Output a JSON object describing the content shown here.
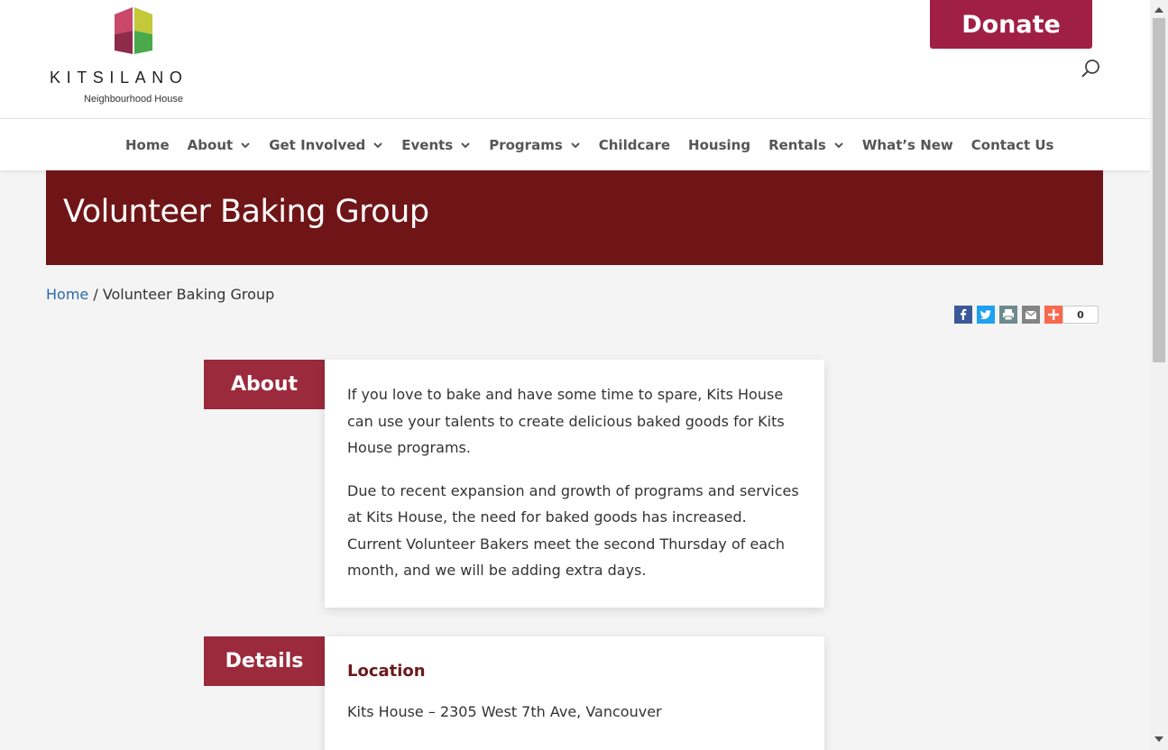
{
  "colors": {
    "brand_red": "#a01f45",
    "banner": "#701517",
    "label_bg": "#9a2a3c",
    "link": "#2a6aa8",
    "heading": "#6b1a1c"
  },
  "logo": {
    "wordmark": "KITSILANO",
    "subtitle": "Neighbourhood House",
    "icon": "kits-house-logo-icon"
  },
  "header": {
    "donate_label": "Donate",
    "search_icon": "search-icon"
  },
  "nav": {
    "items": [
      {
        "label": "Home",
        "has_dropdown": false
      },
      {
        "label": "About",
        "has_dropdown": true
      },
      {
        "label": "Get Involved",
        "has_dropdown": true
      },
      {
        "label": "Events",
        "has_dropdown": true
      },
      {
        "label": "Programs",
        "has_dropdown": true
      },
      {
        "label": "Childcare",
        "has_dropdown": false
      },
      {
        "label": "Housing",
        "has_dropdown": false
      },
      {
        "label": "Rentals",
        "has_dropdown": true
      },
      {
        "label": "What’s New",
        "has_dropdown": false
      },
      {
        "label": "Contact Us",
        "has_dropdown": false
      }
    ]
  },
  "page": {
    "title": "Volunteer Baking Group"
  },
  "breadcrumb": {
    "home": "Home",
    "separator": " / ",
    "current": "Volunteer Baking Group"
  },
  "share": {
    "buttons": [
      "facebook-icon",
      "twitter-icon",
      "print-icon",
      "email-icon",
      "plus-icon"
    ],
    "count": "0"
  },
  "sections": {
    "about": {
      "label": "About",
      "paragraphs": [
        "If you love to bake and have some time to spare, Kits House can use your talents to create delicious baked goods for Kits House programs.",
        "Due to recent expansion and growth of programs and services at Kits House, the need for baked goods has increased. Current Volunteer Bakers meet the second Thursday of each month, and we will be adding extra days."
      ]
    },
    "details": {
      "label": "Details",
      "location_heading": "Location",
      "location_text": "Kits House – 2305 West 7th Ave, Vancouver"
    }
  }
}
